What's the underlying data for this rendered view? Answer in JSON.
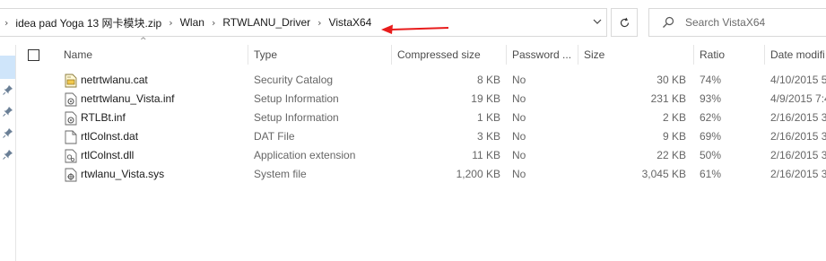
{
  "address": {
    "breadcrumbs": [
      "idea pad Yoga 13 网卡模块.zip",
      "Wlan",
      "RTWLANU_Driver",
      "VistaX64"
    ]
  },
  "search": {
    "placeholder": "Search VistaX64"
  },
  "columns": {
    "name": "Name",
    "type": "Type",
    "compressed_size": "Compressed size",
    "password": "Password ...",
    "size": "Size",
    "ratio": "Ratio",
    "date": "Date modifi"
  },
  "files": [
    {
      "name": "netrtwlanu.cat",
      "type": "Security Catalog",
      "compressed_size": "8 KB",
      "password": "No",
      "size": "30 KB",
      "ratio": "74%",
      "date": "4/10/2015 5",
      "icon": "security-catalog-icon"
    },
    {
      "name": "netrtwlanu_Vista.inf",
      "type": "Setup Information",
      "compressed_size": "19 KB",
      "password": "No",
      "size": "231 KB",
      "ratio": "93%",
      "date": "4/9/2015 7:4",
      "icon": "setup-information-icon"
    },
    {
      "name": "RTLBt.inf",
      "type": "Setup Information",
      "compressed_size": "1 KB",
      "password": "No",
      "size": "2 KB",
      "ratio": "62%",
      "date": "2/16/2015 3",
      "icon": "setup-information-icon"
    },
    {
      "name": "rtlColnst.dat",
      "type": "DAT File",
      "compressed_size": "3 KB",
      "password": "No",
      "size": "9 KB",
      "ratio": "69%",
      "date": "2/16/2015 3",
      "icon": "file-icon"
    },
    {
      "name": "rtlColnst.dll",
      "type": "Application extension",
      "compressed_size": "11 KB",
      "password": "No",
      "size": "22 KB",
      "ratio": "50%",
      "date": "2/16/2015 3",
      "icon": "dll-icon"
    },
    {
      "name": "rtwlanu_Vista.sys",
      "type": "System file",
      "compressed_size": "1,200 KB",
      "password": "No",
      "size": "3,045 KB",
      "ratio": "61%",
      "date": "2/16/2015 3",
      "icon": "system-file-icon"
    }
  ],
  "colors": {
    "annotation_arrow": "#e81c1c",
    "nav_selection": "#cfe5fa",
    "header_text": "#4c4c4c",
    "border": "#d9d9d9"
  }
}
